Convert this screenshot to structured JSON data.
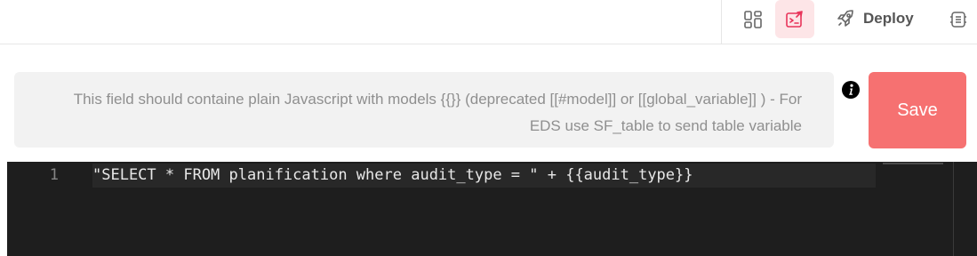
{
  "toolbar": {
    "layout_icon": "layout-grid-icon",
    "code_icon": "code-edit-icon",
    "deploy_icon": "rocket-icon",
    "deploy_label": "Deploy",
    "api_icon": "api-code-icon",
    "active_color": "#e8345a"
  },
  "query": {
    "hint_text": "This field should containe plain Javascript with models {{}} (deprecated [[#model]] or [[global_variable]] ) - For EDS use SF_table to send table variable",
    "info_icon": "info-icon",
    "save_label": "Save",
    "save_color": "#f67171"
  },
  "editor": {
    "line_number": "1",
    "code": "\"SELECT * FROM planification where audit_type = \" + {{audit_type}}",
    "background": "#1e1e1e"
  }
}
